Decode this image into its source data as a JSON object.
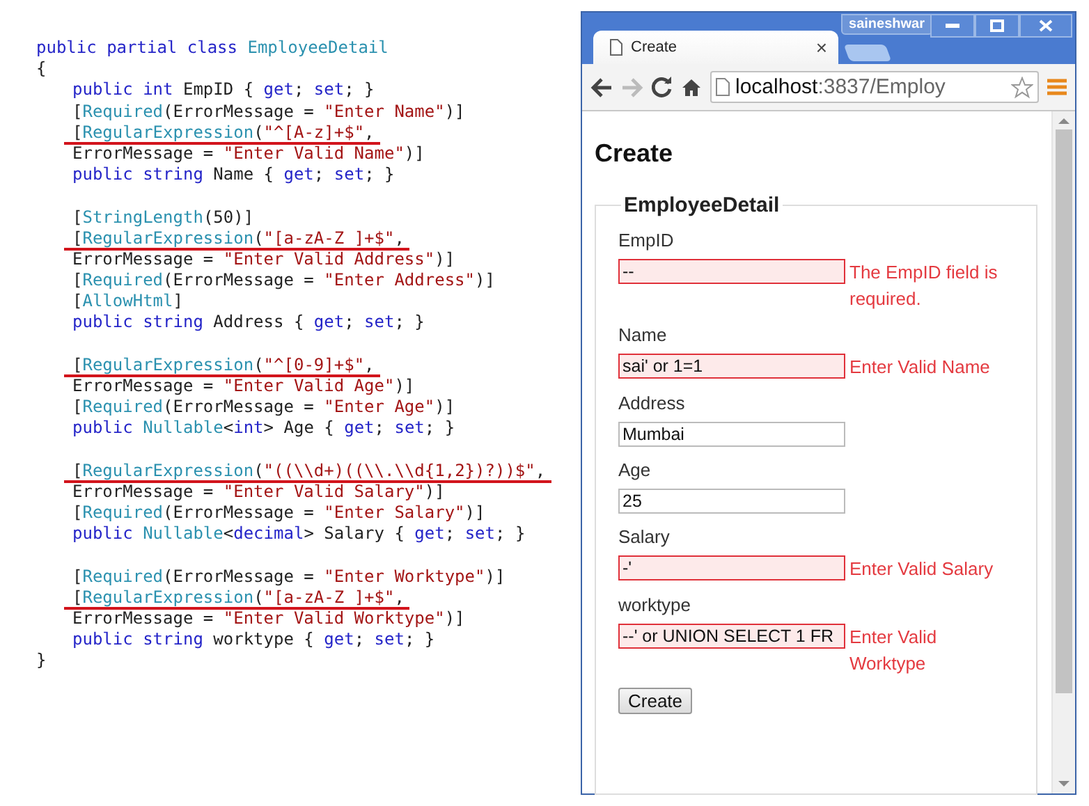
{
  "code": {
    "header": [
      {
        "segments": [
          {
            "kind": "keyword",
            "text": "public partial class "
          },
          {
            "kind": "type",
            "text": "EmployeeDetail"
          }
        ],
        "underlined": false
      },
      {
        "segments": [
          {
            "kind": "plain",
            "text": "{"
          }
        ],
        "underlined": false
      }
    ],
    "blocks": [
      [
        {
          "segments": [
            {
              "kind": "keyword",
              "text": "public int "
            },
            {
              "kind": "plain",
              "text": "EmpID { "
            },
            {
              "kind": "keyword",
              "text": "get"
            },
            {
              "kind": "plain",
              "text": "; "
            },
            {
              "kind": "keyword",
              "text": "set"
            },
            {
              "kind": "plain",
              "text": "; }"
            }
          ],
          "underlined": false
        },
        {
          "segments": [
            {
              "kind": "plain",
              "text": "["
            },
            {
              "kind": "type",
              "text": "Required"
            },
            {
              "kind": "plain",
              "text": "(ErrorMessage = "
            },
            {
              "kind": "string",
              "text": "\"Enter Name\""
            },
            {
              "kind": "plain",
              "text": ")]"
            }
          ],
          "underlined": false
        },
        {
          "segments": [
            {
              "kind": "plain",
              "text": "["
            },
            {
              "kind": "type",
              "text": "RegularExpression"
            },
            {
              "kind": "plain",
              "text": "("
            },
            {
              "kind": "string",
              "text": "\"^[A-z]+$\""
            },
            {
              "kind": "plain",
              "text": ","
            }
          ],
          "underlined": true
        },
        {
          "segments": [
            {
              "kind": "plain",
              "text": "ErrorMessage = "
            },
            {
              "kind": "string",
              "text": "\"Enter Valid Name\""
            },
            {
              "kind": "plain",
              "text": ")]"
            }
          ],
          "underlined": false
        },
        {
          "segments": [
            {
              "kind": "keyword",
              "text": "public string "
            },
            {
              "kind": "plain",
              "text": "Name { "
            },
            {
              "kind": "keyword",
              "text": "get"
            },
            {
              "kind": "plain",
              "text": "; "
            },
            {
              "kind": "keyword",
              "text": "set"
            },
            {
              "kind": "plain",
              "text": "; }"
            }
          ],
          "underlined": false
        }
      ],
      [
        {
          "segments": [
            {
              "kind": "plain",
              "text": "["
            },
            {
              "kind": "type",
              "text": "StringLength"
            },
            {
              "kind": "plain",
              "text": "(50)]"
            }
          ],
          "underlined": false
        },
        {
          "segments": [
            {
              "kind": "plain",
              "text": "["
            },
            {
              "kind": "type",
              "text": "RegularExpression"
            },
            {
              "kind": "plain",
              "text": "("
            },
            {
              "kind": "string",
              "text": "\"[a-zA-Z ]+$\""
            },
            {
              "kind": "plain",
              "text": ","
            }
          ],
          "underlined": true
        },
        {
          "segments": [
            {
              "kind": "plain",
              "text": "ErrorMessage = "
            },
            {
              "kind": "string",
              "text": "\"Enter Valid Address\""
            },
            {
              "kind": "plain",
              "text": ")]"
            }
          ],
          "underlined": false
        },
        {
          "segments": [
            {
              "kind": "plain",
              "text": "["
            },
            {
              "kind": "type",
              "text": "Required"
            },
            {
              "kind": "plain",
              "text": "(ErrorMessage = "
            },
            {
              "kind": "string",
              "text": "\"Enter Address\""
            },
            {
              "kind": "plain",
              "text": ")]"
            }
          ],
          "underlined": false
        },
        {
          "segments": [
            {
              "kind": "plain",
              "text": "["
            },
            {
              "kind": "type",
              "text": "AllowHtml"
            },
            {
              "kind": "plain",
              "text": "]"
            }
          ],
          "underlined": false
        },
        {
          "segments": [
            {
              "kind": "keyword",
              "text": "public string "
            },
            {
              "kind": "plain",
              "text": "Address { "
            },
            {
              "kind": "keyword",
              "text": "get"
            },
            {
              "kind": "plain",
              "text": "; "
            },
            {
              "kind": "keyword",
              "text": "set"
            },
            {
              "kind": "plain",
              "text": "; }"
            }
          ],
          "underlined": false
        }
      ],
      [
        {
          "segments": [
            {
              "kind": "plain",
              "text": "["
            },
            {
              "kind": "type",
              "text": "RegularExpression"
            },
            {
              "kind": "plain",
              "text": "("
            },
            {
              "kind": "string",
              "text": "\"^[0-9]+$\""
            },
            {
              "kind": "plain",
              "text": ","
            }
          ],
          "underlined": true
        },
        {
          "segments": [
            {
              "kind": "plain",
              "text": "ErrorMessage = "
            },
            {
              "kind": "string",
              "text": "\"Enter Valid Age\""
            },
            {
              "kind": "plain",
              "text": ")]"
            }
          ],
          "underlined": false
        },
        {
          "segments": [
            {
              "kind": "plain",
              "text": "["
            },
            {
              "kind": "type",
              "text": "Required"
            },
            {
              "kind": "plain",
              "text": "(ErrorMessage = "
            },
            {
              "kind": "string",
              "text": "\"Enter Age\""
            },
            {
              "kind": "plain",
              "text": ")]"
            }
          ],
          "underlined": false
        },
        {
          "segments": [
            {
              "kind": "keyword",
              "text": "public "
            },
            {
              "kind": "type",
              "text": "Nullable"
            },
            {
              "kind": "plain",
              "text": "<"
            },
            {
              "kind": "keyword",
              "text": "int"
            },
            {
              "kind": "plain",
              "text": "> Age { "
            },
            {
              "kind": "keyword",
              "text": "get"
            },
            {
              "kind": "plain",
              "text": "; "
            },
            {
              "kind": "keyword",
              "text": "set"
            },
            {
              "kind": "plain",
              "text": "; }"
            }
          ],
          "underlined": false
        }
      ],
      [
        {
          "segments": [
            {
              "kind": "plain",
              "text": "["
            },
            {
              "kind": "type",
              "text": "RegularExpression"
            },
            {
              "kind": "plain",
              "text": "("
            },
            {
              "kind": "string",
              "text": "\"((\\\\d+)((\\\\.\\\\d{1,2})?))$\""
            },
            {
              "kind": "plain",
              "text": ","
            }
          ],
          "underlined": true
        },
        {
          "segments": [
            {
              "kind": "plain",
              "text": "ErrorMessage = "
            },
            {
              "kind": "string",
              "text": "\"Enter Valid Salary\""
            },
            {
              "kind": "plain",
              "text": ")]"
            }
          ],
          "underlined": false
        },
        {
          "segments": [
            {
              "kind": "plain",
              "text": "["
            },
            {
              "kind": "type",
              "text": "Required"
            },
            {
              "kind": "plain",
              "text": "(ErrorMessage = "
            },
            {
              "kind": "string",
              "text": "\"Enter Salary\""
            },
            {
              "kind": "plain",
              "text": ")]"
            }
          ],
          "underlined": false
        },
        {
          "segments": [
            {
              "kind": "keyword",
              "text": "public "
            },
            {
              "kind": "type",
              "text": "Nullable"
            },
            {
              "kind": "plain",
              "text": "<"
            },
            {
              "kind": "keyword",
              "text": "decimal"
            },
            {
              "kind": "plain",
              "text": "> Salary { "
            },
            {
              "kind": "keyword",
              "text": "get"
            },
            {
              "kind": "plain",
              "text": "; "
            },
            {
              "kind": "keyword",
              "text": "set"
            },
            {
              "kind": "plain",
              "text": "; }"
            }
          ],
          "underlined": false
        }
      ],
      [
        {
          "segments": [
            {
              "kind": "plain",
              "text": "["
            },
            {
              "kind": "type",
              "text": "Required"
            },
            {
              "kind": "plain",
              "text": "(ErrorMessage = "
            },
            {
              "kind": "string",
              "text": "\"Enter Worktype\""
            },
            {
              "kind": "plain",
              "text": ")]"
            }
          ],
          "underlined": false
        },
        {
          "segments": [
            {
              "kind": "plain",
              "text": "["
            },
            {
              "kind": "type",
              "text": "RegularExpression"
            },
            {
              "kind": "plain",
              "text": "("
            },
            {
              "kind": "string",
              "text": "\"[a-zA-Z ]+$\""
            },
            {
              "kind": "plain",
              "text": ","
            }
          ],
          "underlined": true
        },
        {
          "segments": [
            {
              "kind": "plain",
              "text": "ErrorMessage = "
            },
            {
              "kind": "string",
              "text": "\"Enter Valid Worktype\""
            },
            {
              "kind": "plain",
              "text": ")]"
            }
          ],
          "underlined": false
        },
        {
          "segments": [
            {
              "kind": "keyword",
              "text": "public string "
            },
            {
              "kind": "plain",
              "text": "worktype { "
            },
            {
              "kind": "keyword",
              "text": "get"
            },
            {
              "kind": "plain",
              "text": "; "
            },
            {
              "kind": "keyword",
              "text": "set"
            },
            {
              "kind": "plain",
              "text": "; }"
            }
          ],
          "underlined": false
        }
      ]
    ],
    "footer": [
      {
        "segments": [
          {
            "kind": "plain",
            "text": "}"
          }
        ],
        "underlined": false
      }
    ]
  },
  "browser": {
    "user": "saineshwar",
    "tab": {
      "title": "Create",
      "close": "×"
    },
    "address": {
      "host": "localhost",
      "path": ":3837/Employ"
    },
    "page": {
      "heading": "Create",
      "legend": "EmployeeDetail",
      "fields": [
        {
          "label": "EmpID",
          "value": "--",
          "invalid": true,
          "error": "The EmpID field is required."
        },
        {
          "label": "Name",
          "value": "sai' or 1=1",
          "invalid": true,
          "error": "Enter Valid Name"
        },
        {
          "label": "Address",
          "value": "Mumbai",
          "invalid": false
        },
        {
          "label": "Age",
          "value": "25",
          "invalid": false
        },
        {
          "label": "Salary",
          "value": "-'",
          "invalid": true,
          "error": "Enter Valid Salary"
        },
        {
          "label": "worktype",
          "value": "--' or UNION SELECT 1 FR",
          "invalid": true,
          "error": "Enter Valid Worktype"
        }
      ],
      "submit": "Create"
    }
  }
}
